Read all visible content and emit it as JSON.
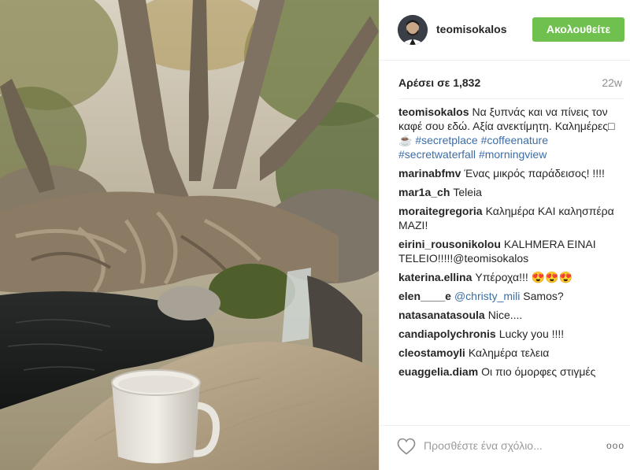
{
  "post": {
    "username": "teomisokalos",
    "follow_label": "Ακολουθείτε",
    "likes": "Αρέσει σε 1,832",
    "time_ago": "22w"
  },
  "caption": {
    "user": "teomisokalos",
    "text": "Να ξυπνάς και να πίνεις τον καφέ σου εδώ. Αξία ανεκτίμητη. Καλημέρες□☕",
    "hashtags": [
      "#secretplace",
      "#coffeenature",
      "#secretwaterfall",
      "#morningview"
    ]
  },
  "comments": [
    {
      "user": "marinabfmv",
      "text": "Ένας μικρός παράδεισος! !!!!"
    },
    {
      "user": "mar1a_ch",
      "text": "Teleia"
    },
    {
      "user": "moraitegregoria",
      "text": "Καλημέρα ΚΑΙ καλησπέρα ΜΑΖΙ!"
    },
    {
      "user": "eirini_rousonikolou",
      "text": "KALHMERA EINAI TELEIO!!!!!@teomisokalos"
    },
    {
      "user": "katerina.ellina",
      "text": "Υπέροχα!!! 😍😍😍"
    },
    {
      "user": "elen____e",
      "mention": "@christy_mili",
      "text": "Samos?"
    },
    {
      "user": "natasanatasoula",
      "text": "Nice...."
    },
    {
      "user": "candiapolychronis",
      "text": "Lucky you !!!!"
    },
    {
      "user": "cleostamoyli",
      "text": "Καλημέρα τελεια"
    },
    {
      "user": "euaggelia.diam",
      "text": "Οι πιο όμορφες στιγμές"
    }
  ],
  "footer": {
    "placeholder": "Προσθέστε ένα σχόλιο...",
    "more": "ooo",
    "like_icon": "heart-icon"
  },
  "colors": {
    "follow": "#70c050",
    "link": "#3c6ea6"
  }
}
